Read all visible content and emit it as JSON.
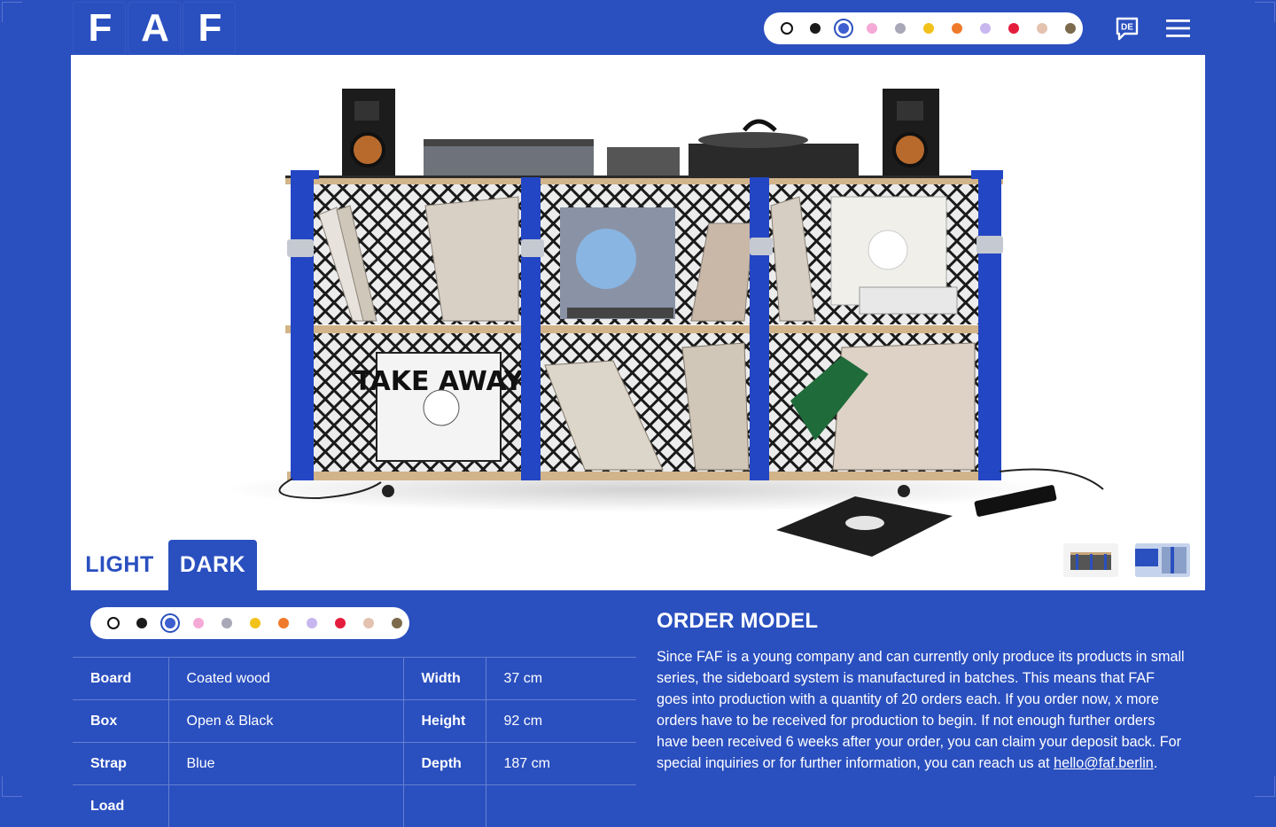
{
  "brand": {
    "letters": [
      "F",
      "A",
      "F"
    ]
  },
  "colors": {
    "accent": "#2a4fbf",
    "swatches": [
      "#ffffff",
      "#1b1b1b",
      "#3d5fcf",
      "#f5a9d6",
      "#a8a8b8",
      "#f2c21b",
      "#f07a2b",
      "#c8b6ef",
      "#e51d3c",
      "#e3c2b0",
      "#7c6a4d"
    ],
    "selected_swatch_index": 2
  },
  "header": {
    "language_label": "DE",
    "menu_icon": "hamburger-icon",
    "language_icon": "speech-bubble-icon"
  },
  "variants": {
    "light": "LIGHT",
    "dark": "DARK",
    "active": "DARK"
  },
  "specs": {
    "rows": [
      {
        "k1": "Board",
        "v1": "Coated wood",
        "k2": "Width",
        "v2": "37 cm"
      },
      {
        "k1": "Box",
        "v1": "Open & Black",
        "k2": "Height",
        "v2": "92 cm"
      },
      {
        "k1": "Strap",
        "v1": "Blue",
        "k2": "Depth",
        "v2": "187 cm"
      },
      {
        "k1": "Load",
        "v1": "",
        "k2": "",
        "v2": ""
      }
    ]
  },
  "order": {
    "title": "ORDER MODEL",
    "text": "Since FAF is a young company and can currently only produce its products in small series, the sideboard system is manufactured in batches. This means that FAF goes into production with a quantity of 20 orders each. If you order now, x more orders have to be received for production to begin. If not enough further orders have been received 6 weeks after your order, you can claim your deposit back. For special inquiries or for further information, you can reach us at ",
    "email": "hello@faf.berlin",
    "end": "."
  }
}
